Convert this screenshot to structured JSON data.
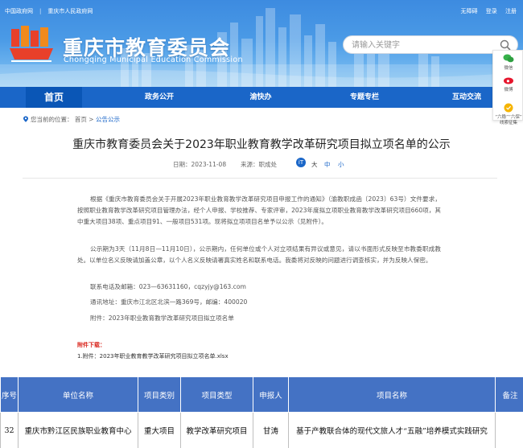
{
  "top_links": {
    "left1": "中国政府网",
    "left2": "重庆市人民政府网",
    "right": [
      "无障碍",
      "登录",
      "注册"
    ]
  },
  "header": {
    "title": "重庆市教育委员会",
    "subtitle": "Chongqing Municipal Education Commission"
  },
  "search": {
    "placeholder": "请输入关键字"
  },
  "nav": {
    "items": [
      "首页",
      "政务公开",
      "渝快办",
      "专题专栏",
      "互动交流"
    ],
    "active": "首页"
  },
  "side_bar": {
    "items": [
      "微信",
      "微博",
      "“六稳”“六保”\n线索征集"
    ]
  },
  "breadcrumb": {
    "label": "您当前的位置：",
    "home": "首页",
    "sep": ">",
    "current": "公告公示"
  },
  "article": {
    "title": "重庆市教育委员会关于2023年职业教育教学改革研究项目拟立项名单的公示",
    "date_label": "日期：",
    "date": "2023-11-08",
    "source_label": "来源：",
    "source": "职成处",
    "font_sizes": [
      "大",
      "中",
      "小"
    ],
    "paragraph1": "根据《重庆市教育委员会关于开展2023年职业教育教学改革研究项目申报工作的通知》（渝教职成函〔2023〕63号）文件要求，按照职业教育教学改革研究项目管理办法，经个人申报、学校推荐、专家评审，2023年度拟立项职业教育教学改革研究项目660项，其中重大项目38项、重点项目91、一般项目531项。现将拟立项项目名单予以公示（见附件）。",
    "paragraph2": "公示期为3天（11月8日—11月10日），公示期内，任何单位或个人对立项结果有异议或意见，请以书面形式反映至市教委职成教处。以单位名义反映请加盖公章，以个人名义反映请署真实姓名和联系电话。我委将对反映的问题进行调查核实，并为反映人保密。",
    "contact": "联系电话及邮箱：023—63631160，cqzyjy@163.com",
    "address": "通讯地址：重庆市江北区北滨一路369号，邮编：400020",
    "attachment_line": "附件：2023年职业教育教学改革研究项目拟立项名单"
  },
  "attachments": {
    "title": "附件下载：",
    "file": "1.附件：2023年职业教育教学改革研究项目拟立项名单.xlsx"
  },
  "table": {
    "headers": [
      "序号",
      "单位名称",
      "项目类别",
      "项目类型",
      "申报人",
      "项目名称",
      "备注"
    ],
    "rows": [
      [
        "32",
        "重庆市黔江区民族职业教育中心",
        "重大项目",
        "教学改革研究项目",
        "甘涛",
        "基于产教联合体的现代文旅人才“五融”培养模式实践研究",
        ""
      ]
    ]
  },
  "colors": {
    "nav": "#1a66c8",
    "header_blue": "#3d8be0",
    "table_header": "#4472c4",
    "attach_red": "#d9251c"
  }
}
